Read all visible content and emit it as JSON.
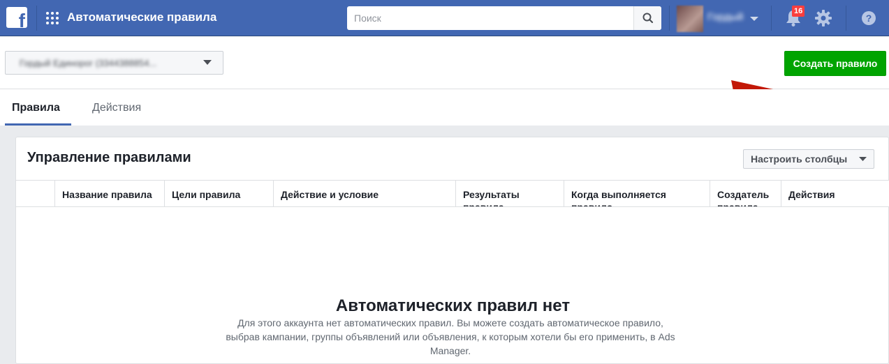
{
  "header": {
    "logo_letter": "f",
    "app_title": "Автоматические правила",
    "search_placeholder": "Поиск",
    "notifications_count": "16",
    "accent": "#4267b2"
  },
  "account": {
    "selector_value": "Гордый Единорог (3344388854..."
  },
  "actions": {
    "create_rule_label": "Создать правило",
    "create_rule_color": "#00a400"
  },
  "tabs": [
    {
      "label": "Правила",
      "active": true
    },
    {
      "label": "Действия",
      "active": false
    }
  ],
  "panel": {
    "title": "Управление правилами",
    "columns_button": "Настроить столбцы",
    "columns": [
      "",
      "Название правила",
      "Цели правила",
      "Действие и условие",
      "Результаты правила",
      "Когда выполняется правило",
      "Создатель правила",
      "Действия"
    ],
    "empty_title": "Автоматических правил нет",
    "empty_text": "Для этого аккаунта нет автоматических правил. Вы можете создать автоматическое правило, выбрав кампании, группы объявлений или объявления, к которым хотели бы его применить, в Ads Manager."
  },
  "icons": {
    "logo": "facebook-logo-icon",
    "apps": "apps-grid-icon",
    "search": "search-icon",
    "notifications": "bell-icon",
    "settings": "gear-icon",
    "help": "help-icon",
    "dropdown": "caret-down-icon"
  }
}
